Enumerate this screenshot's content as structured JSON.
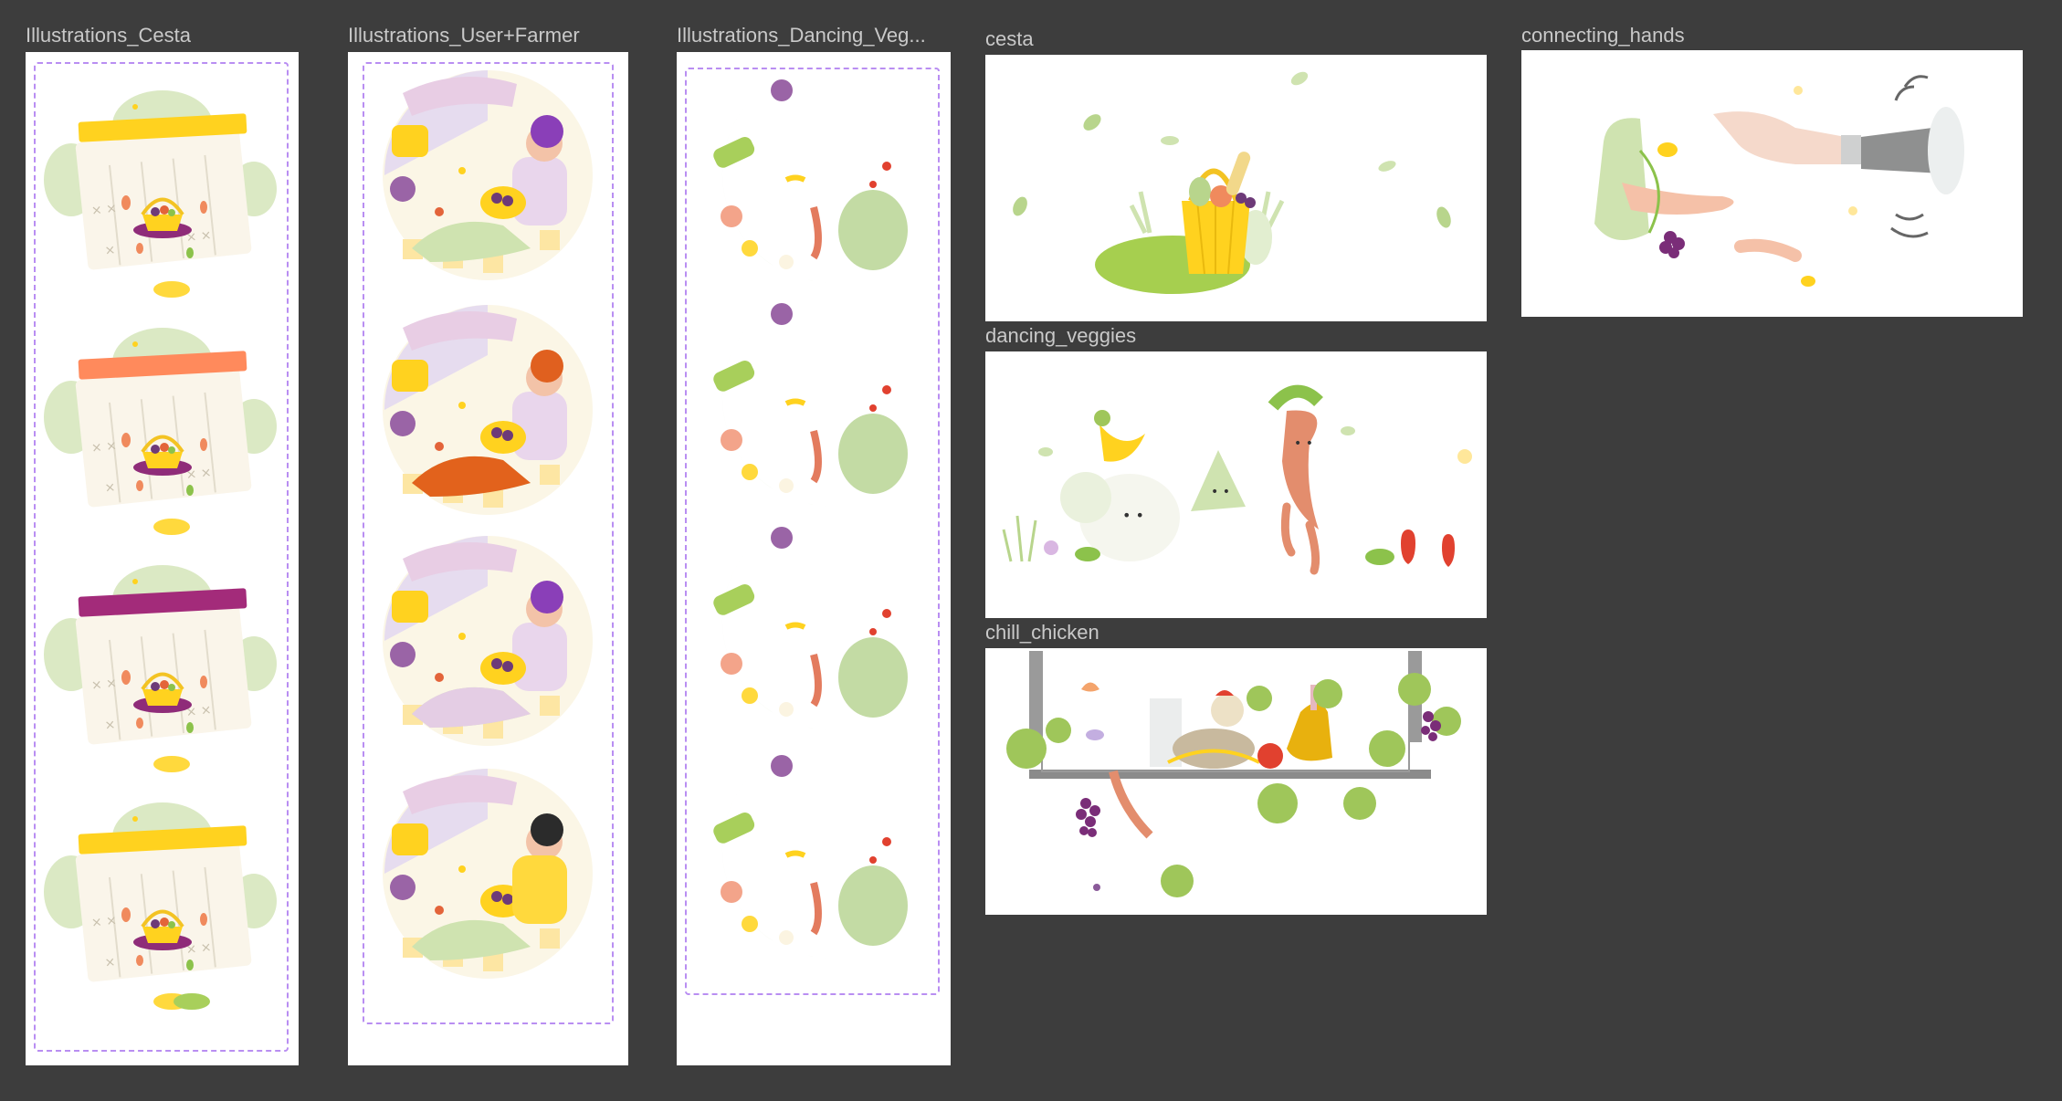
{
  "canvas": {
    "background": "#3d3d3d"
  },
  "frames": [
    {
      "id": "cesta-variants",
      "label": "Illustrations_Cesta"
    },
    {
      "id": "user-farmer",
      "label": "Illustrations_User+Farmer"
    },
    {
      "id": "dancing-variants",
      "label": "Illustrations_Dancing_Veg..."
    },
    {
      "id": "cesta",
      "label": "cesta"
    },
    {
      "id": "connecting-hands",
      "label": "connecting_hands"
    },
    {
      "id": "dancing-veggies",
      "label": "dancing_veggies"
    },
    {
      "id": "chill-chicken",
      "label": "chill_chicken"
    }
  ],
  "cesta_variant_header_colors": [
    "#ffd21f",
    "#ff8a5c",
    "#a32b7a",
    "#ffd21f"
  ],
  "farmer_variant_hair_colors": [
    "#8a3fb8",
    "#e0601f",
    "#8a3fb8",
    "#2b2b2b"
  ],
  "colors": {
    "selection_dash": "#b98ef2",
    "label": "#c9c9c9",
    "accent_yellow": "#ffd21f",
    "leaf_green": "#a8cf5b",
    "grape": "#7a2d78"
  }
}
